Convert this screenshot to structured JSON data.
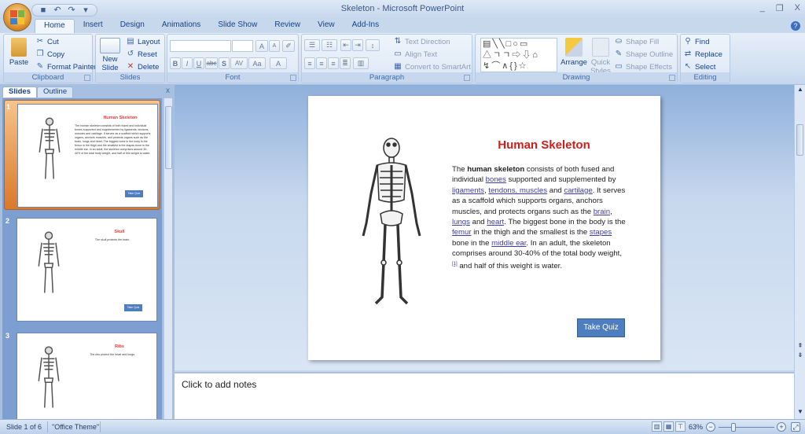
{
  "window": {
    "title": "Skeleton - Microsoft PowerPoint",
    "controls": {
      "minimize": "_",
      "restore": "❐",
      "close": "X"
    }
  },
  "quick_access": [
    {
      "icon": "save-icon",
      "glyph": "■"
    },
    {
      "icon": "undo-icon",
      "glyph": "↶"
    },
    {
      "icon": "redo-icon",
      "glyph": "↷"
    },
    {
      "icon": "customize-icon",
      "glyph": "▾"
    }
  ],
  "tabs": [
    "Home",
    "Insert",
    "Design",
    "Animations",
    "Slide Show",
    "Review",
    "View",
    "Add-Ins"
  ],
  "active_tab": "Home",
  "ribbon": {
    "clipboard": {
      "label": "Clipboard",
      "paste": "Paste",
      "cut": "Cut",
      "copy": "Copy",
      "format_painter": "Format Painter"
    },
    "slides": {
      "label": "Slides",
      "new_slide": "New Slide",
      "layout": "Layout",
      "reset": "Reset",
      "delete": "Delete"
    },
    "font": {
      "label": "Font",
      "font_name": "",
      "font_size": "",
      "bold": "B",
      "italic": "I",
      "underline": "U",
      "strike": "abc",
      "shadow": "S",
      "spacing": "AV",
      "case": "Aa",
      "color": "A",
      "grow": "A",
      "shrink": "A"
    },
    "paragraph": {
      "label": "Paragraph",
      "text_direction": "Text Direction",
      "align_text": "Align Text",
      "convert_smartart": "Convert to SmartArt"
    },
    "drawing": {
      "label": "Drawing",
      "arrange": "Arrange",
      "quick_styles": "Quick Styles",
      "shape_fill": "Shape Fill",
      "shape_outline": "Shape Outline",
      "shape_effects": "Shape Effects",
      "shapes_row1": "▤╲╲□○▭",
      "shapes_row2": "△ㄱㄱ⇨⇩⌂",
      "shapes_row3": "↯⌒∧{}☆"
    },
    "editing": {
      "label": "Editing",
      "find": "Find",
      "replace": "Replace",
      "select": "Select"
    }
  },
  "panel": {
    "tabs": [
      "Slides",
      "Outline"
    ],
    "active_tab": "Slides",
    "close": "x",
    "thumbnails": [
      {
        "number": "1",
        "title": "Human Skeleton",
        "text": "The human skeleton consists of both fused and individual bones supported and supplemented by ligaments, tendons, muscles and cartilage. It serves as a scaffold which supports organs, anchors muscles, and protects organs such as the brain, lungs and heart. The biggest bone in the body is the femur in the thigh and the smallest is the stapes bone in the middle ear. In an adult, the skeleton comprises around 30-40% of the total body weight, and half of this weight is water.",
        "button": "Take Quiz",
        "selected": true
      },
      {
        "number": "2",
        "title": "Skull",
        "text": "The skull protects the brain.",
        "button": "Take Quiz",
        "selected": false
      },
      {
        "number": "3",
        "title": "Ribs",
        "text": "The ribs protect the heart and lungs.",
        "button": "",
        "selected": false
      }
    ]
  },
  "slide": {
    "title": "Human Skeleton",
    "body": {
      "p1": "The ",
      "bold": "human skeleton",
      "p2": " consists of both fused and individual ",
      "l_bones": "bones",
      "p3": " supported and supplemented by ",
      "l_ligaments": "ligaments",
      "p4": ", ",
      "l_tendons": "tendons, muscles",
      "p5": " and ",
      "l_cartilage": "cartilage",
      "p6": ". It serves as a scaffold which supports organs, anchors muscles, and protects organs such as the ",
      "l_brain": "brain",
      "p7": ", ",
      "l_lungs": "lungs",
      "p8": " and ",
      "l_heart": "heart",
      "p9": ". The biggest bone in the body is the ",
      "l_femur": "femur",
      "p10": " in the thigh and the smallest is the ",
      "l_stapes": "stapes",
      "p11": " bone in the ",
      "l_middle_ear": "middle ear",
      "p12": ". In an adult, the skeleton comprises around 30-40% of the total body weight,",
      "ref": "[1]",
      "p13": " and half of this weight is water."
    },
    "button": "Take Quiz"
  },
  "notes": {
    "placeholder": "Click to add notes"
  },
  "status": {
    "slide_info": "Slide 1 of 6",
    "theme": "\"Office Theme\"",
    "zoom": "63%",
    "zoom_value_percent": 63
  },
  "colors": {
    "title_red": "#d41c1c",
    "link_blue": "#3e3ea8",
    "quiz_button": "#4f7ec0",
    "ribbon_text": "#15428b"
  }
}
